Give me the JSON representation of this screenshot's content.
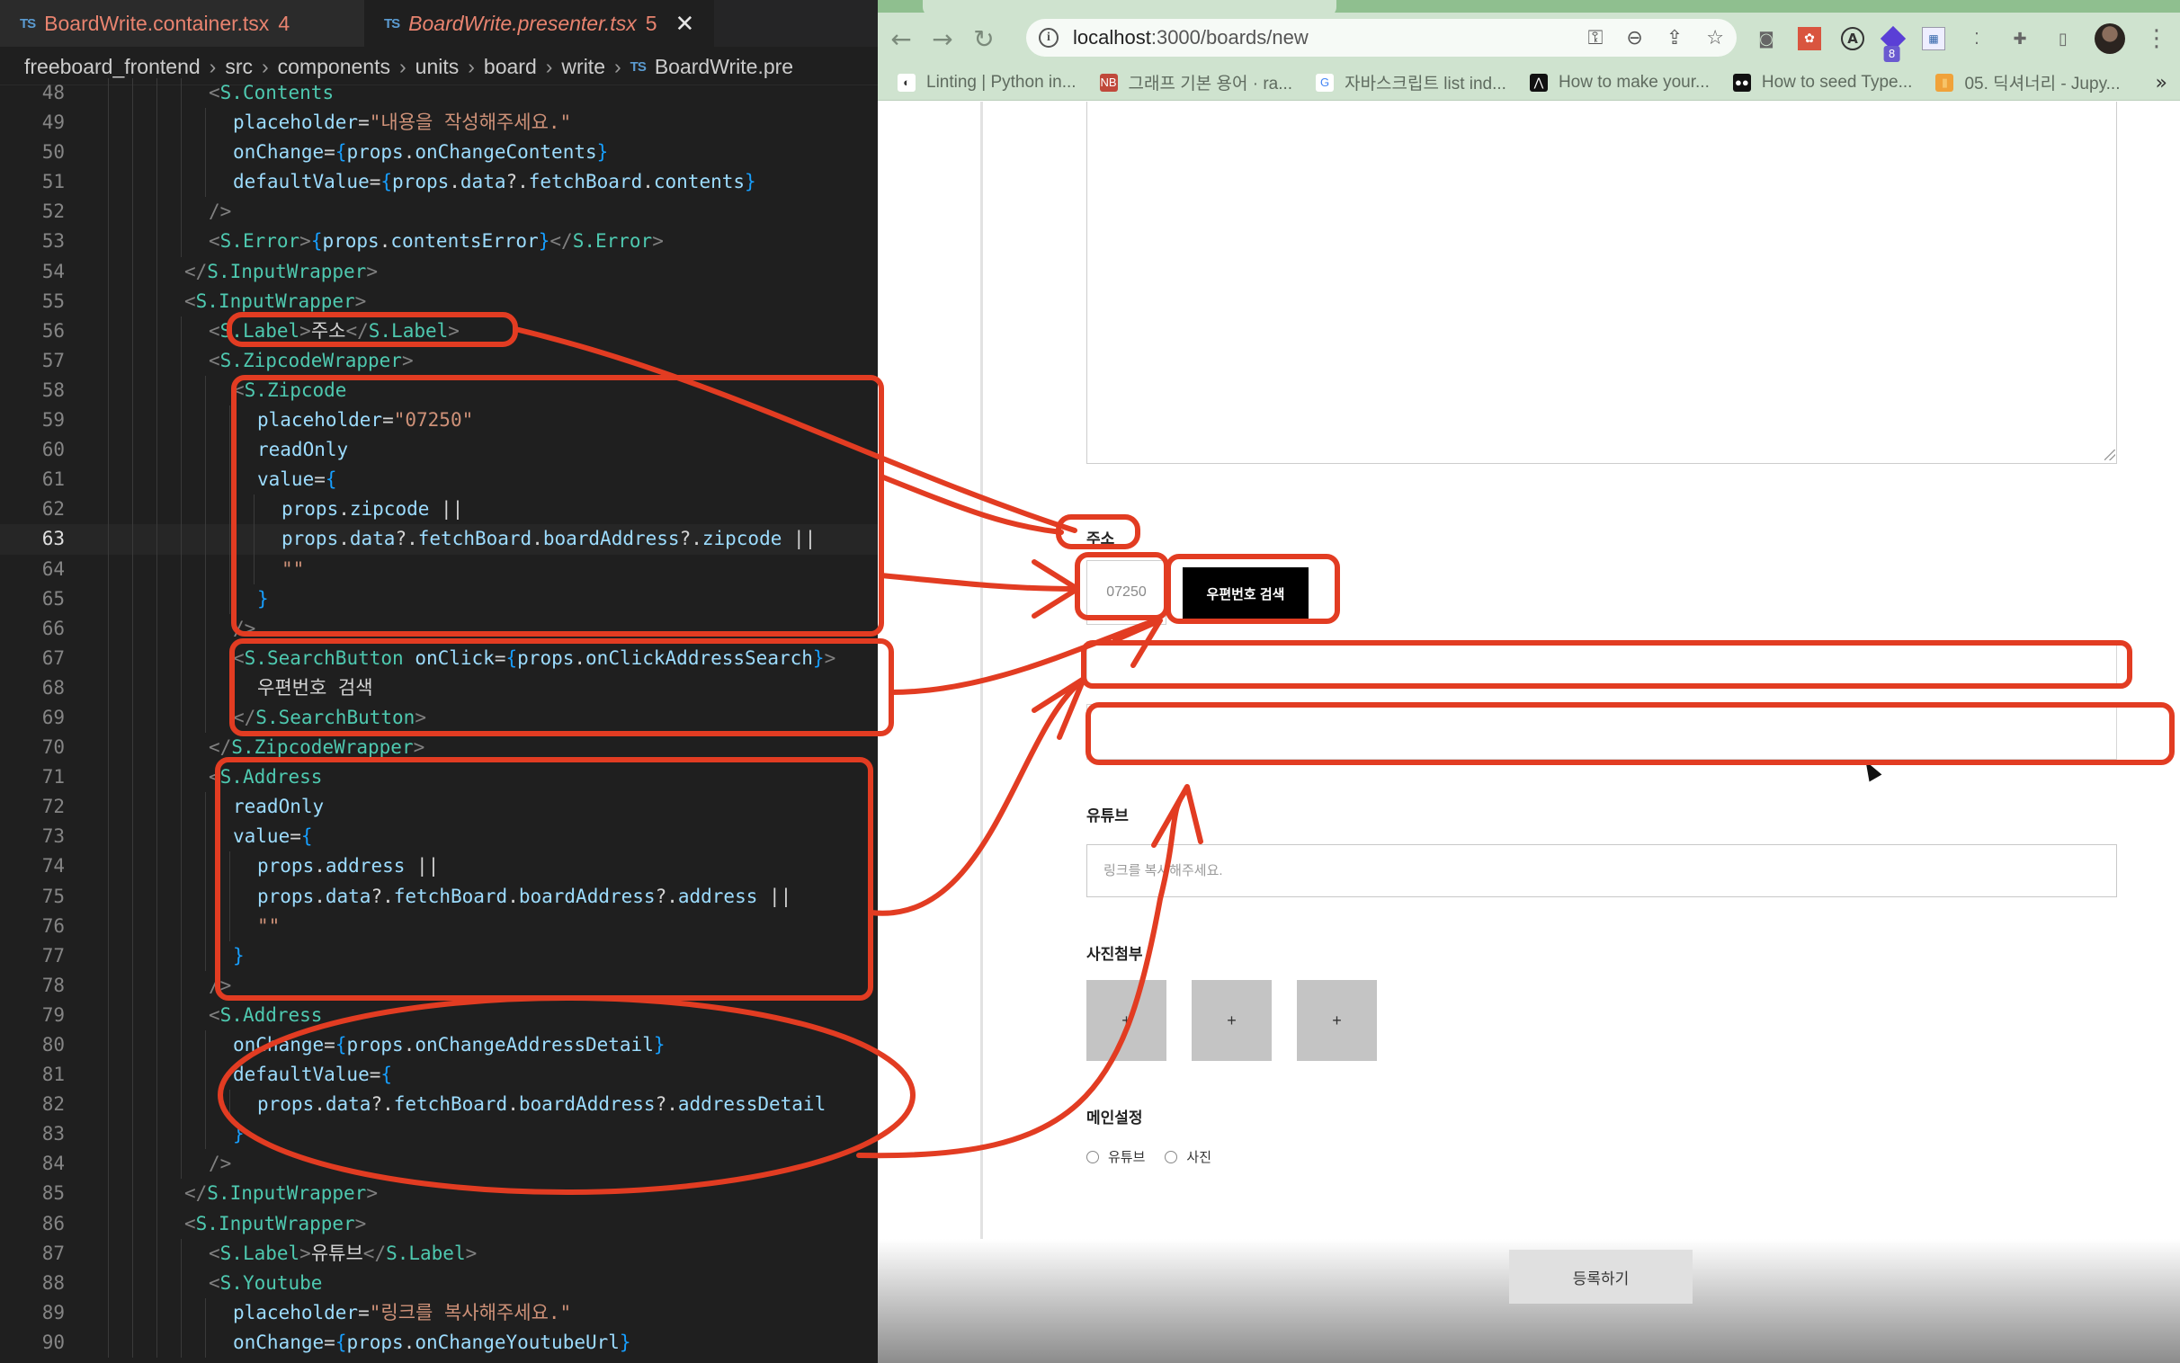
{
  "editor": {
    "tabs": [
      {
        "badge": "TS",
        "name": "BoardWrite.container.tsx",
        "count": "4",
        "active": false
      },
      {
        "badge": "TS",
        "name": "BoardWrite.presenter.tsx",
        "count": "5",
        "active": true,
        "close": "✕"
      }
    ],
    "breadcrumb": [
      "freeboard_frontend",
      "src",
      "components",
      "units",
      "board",
      "write",
      "BoardWrite.pre"
    ],
    "breadcrumb_sep": "›",
    "breadcrumb_file_badge": "TS",
    "current_line": 63,
    "lines": [
      {
        "n": "48",
        "indent": 4,
        "t": [
          [
            "tg",
            "<"
          ],
          [
            "cp",
            "S.Contents"
          ]
        ]
      },
      {
        "n": "49",
        "indent": 5,
        "t": [
          [
            "at",
            "placeholder"
          ],
          [
            "pl",
            "="
          ],
          [
            "st",
            "\"내용을 작성해주세요.\""
          ]
        ]
      },
      {
        "n": "50",
        "indent": 5,
        "t": [
          [
            "at",
            "onChange"
          ],
          [
            "pl",
            "="
          ],
          [
            "br",
            "{"
          ],
          [
            "vr",
            "props"
          ],
          [
            "pl",
            "."
          ],
          [
            "vr",
            "onChangeContents"
          ],
          [
            "br",
            "}"
          ]
        ]
      },
      {
        "n": "51",
        "indent": 5,
        "t": [
          [
            "at",
            "defaultValue"
          ],
          [
            "pl",
            "="
          ],
          [
            "br",
            "{"
          ],
          [
            "vr",
            "props"
          ],
          [
            "pl",
            "."
          ],
          [
            "vr",
            "data"
          ],
          [
            "pl",
            "?."
          ],
          [
            "vr",
            "fetchBoard"
          ],
          [
            "pl",
            "."
          ],
          [
            "vr",
            "contents"
          ],
          [
            "br",
            "}"
          ]
        ]
      },
      {
        "n": "52",
        "indent": 4,
        "t": [
          [
            "tg",
            "/>"
          ]
        ]
      },
      {
        "n": "53",
        "indent": 4,
        "t": [
          [
            "tg",
            "<"
          ],
          [
            "cp",
            "S.Error"
          ],
          [
            "tg",
            ">"
          ],
          [
            "br",
            "{"
          ],
          [
            "vr",
            "props"
          ],
          [
            "pl",
            "."
          ],
          [
            "vr",
            "contentsError"
          ],
          [
            "br",
            "}"
          ],
          [
            "tg",
            "</"
          ],
          [
            "cp",
            "S.Error"
          ],
          [
            "tg",
            ">"
          ]
        ]
      },
      {
        "n": "54",
        "indent": 3,
        "t": [
          [
            "tg",
            "</"
          ],
          [
            "cp",
            "S.InputWrapper"
          ],
          [
            "tg",
            ">"
          ]
        ]
      },
      {
        "n": "55",
        "indent": 3,
        "t": [
          [
            "tg",
            "<"
          ],
          [
            "cp",
            "S.InputWrapper"
          ],
          [
            "tg",
            ">"
          ]
        ]
      },
      {
        "n": "56",
        "indent": 4,
        "t": [
          [
            "tg",
            "<"
          ],
          [
            "cp",
            "S.Label"
          ],
          [
            "tg",
            ">"
          ],
          [
            "pl",
            "주소"
          ],
          [
            "tg",
            "</"
          ],
          [
            "cp",
            "S.Label"
          ],
          [
            "tg",
            ">"
          ]
        ]
      },
      {
        "n": "57",
        "indent": 4,
        "t": [
          [
            "tg",
            "<"
          ],
          [
            "cp",
            "S.ZipcodeWrapper"
          ],
          [
            "tg",
            ">"
          ]
        ]
      },
      {
        "n": "58",
        "indent": 5,
        "t": [
          [
            "tg",
            "<"
          ],
          [
            "cp",
            "S.Zipcode"
          ]
        ]
      },
      {
        "n": "59",
        "indent": 6,
        "t": [
          [
            "at",
            "placeholder"
          ],
          [
            "pl",
            "="
          ],
          [
            "st",
            "\"07250\""
          ]
        ]
      },
      {
        "n": "60",
        "indent": 6,
        "t": [
          [
            "at",
            "readOnly"
          ]
        ]
      },
      {
        "n": "61",
        "indent": 6,
        "t": [
          [
            "at",
            "value"
          ],
          [
            "pl",
            "="
          ],
          [
            "br",
            "{"
          ]
        ]
      },
      {
        "n": "62",
        "indent": 7,
        "t": [
          [
            "vr",
            "props"
          ],
          [
            "pl",
            "."
          ],
          [
            "vr",
            "zipcode"
          ],
          [
            "pl",
            " ||"
          ]
        ]
      },
      {
        "n": "63",
        "indent": 7,
        "t": [
          [
            "vr",
            "props"
          ],
          [
            "pl",
            "."
          ],
          [
            "vr",
            "data"
          ],
          [
            "pl",
            "?."
          ],
          [
            "vr",
            "fetchBoard"
          ],
          [
            "pl",
            "."
          ],
          [
            "vr",
            "boardAddress"
          ],
          [
            "pl",
            "?."
          ],
          [
            "vr",
            "zipcode"
          ],
          [
            "pl",
            " ||"
          ]
        ]
      },
      {
        "n": "64",
        "indent": 7,
        "t": [
          [
            "st",
            "\"\""
          ]
        ]
      },
      {
        "n": "65",
        "indent": 6,
        "t": [
          [
            "br",
            "}"
          ]
        ]
      },
      {
        "n": "66",
        "indent": 5,
        "t": [
          [
            "tg",
            "/>"
          ]
        ]
      },
      {
        "n": "67",
        "indent": 5,
        "t": [
          [
            "tg",
            "<"
          ],
          [
            "cp",
            "S.SearchButton"
          ],
          [
            "pl",
            " "
          ],
          [
            "at",
            "onClick"
          ],
          [
            "pl",
            "="
          ],
          [
            "br",
            "{"
          ],
          [
            "vr",
            "props"
          ],
          [
            "pl",
            "."
          ],
          [
            "vr",
            "onClickAddressSearch"
          ],
          [
            "br",
            "}"
          ],
          [
            "tg",
            ">"
          ]
        ]
      },
      {
        "n": "68",
        "indent": 6,
        "t": [
          [
            "pl",
            "우편번호 검색"
          ]
        ]
      },
      {
        "n": "69",
        "indent": 5,
        "t": [
          [
            "tg",
            "</"
          ],
          [
            "cp",
            "S.SearchButton"
          ],
          [
            "tg",
            ">"
          ]
        ]
      },
      {
        "n": "70",
        "indent": 4,
        "t": [
          [
            "tg",
            "</"
          ],
          [
            "cp",
            "S.ZipcodeWrapper"
          ],
          [
            "tg",
            ">"
          ]
        ]
      },
      {
        "n": "71",
        "indent": 4,
        "t": [
          [
            "tg",
            "<"
          ],
          [
            "cp",
            "S.Address"
          ]
        ]
      },
      {
        "n": "72",
        "indent": 5,
        "t": [
          [
            "at",
            "readOnly"
          ]
        ]
      },
      {
        "n": "73",
        "indent": 5,
        "t": [
          [
            "at",
            "value"
          ],
          [
            "pl",
            "="
          ],
          [
            "br",
            "{"
          ]
        ]
      },
      {
        "n": "74",
        "indent": 6,
        "t": [
          [
            "vr",
            "props"
          ],
          [
            "pl",
            "."
          ],
          [
            "vr",
            "address"
          ],
          [
            "pl",
            " ||"
          ]
        ]
      },
      {
        "n": "75",
        "indent": 6,
        "t": [
          [
            "vr",
            "props"
          ],
          [
            "pl",
            "."
          ],
          [
            "vr",
            "data"
          ],
          [
            "pl",
            "?."
          ],
          [
            "vr",
            "fetchBoard"
          ],
          [
            "pl",
            "."
          ],
          [
            "vr",
            "boardAddress"
          ],
          [
            "pl",
            "?."
          ],
          [
            "vr",
            "address"
          ],
          [
            "pl",
            " ||"
          ]
        ]
      },
      {
        "n": "76",
        "indent": 6,
        "t": [
          [
            "st",
            "\"\""
          ]
        ]
      },
      {
        "n": "77",
        "indent": 5,
        "t": [
          [
            "br",
            "}"
          ]
        ]
      },
      {
        "n": "78",
        "indent": 4,
        "t": [
          [
            "tg",
            "/>"
          ]
        ]
      },
      {
        "n": "79",
        "indent": 4,
        "t": [
          [
            "tg",
            "<"
          ],
          [
            "cp",
            "S.Address"
          ]
        ]
      },
      {
        "n": "80",
        "indent": 5,
        "t": [
          [
            "at",
            "onChange"
          ],
          [
            "pl",
            "="
          ],
          [
            "br",
            "{"
          ],
          [
            "vr",
            "props"
          ],
          [
            "pl",
            "."
          ],
          [
            "vr",
            "onChangeAddressDetail"
          ],
          [
            "br",
            "}"
          ]
        ]
      },
      {
        "n": "81",
        "indent": 5,
        "t": [
          [
            "at",
            "defaultValue"
          ],
          [
            "pl",
            "="
          ],
          [
            "br",
            "{"
          ]
        ]
      },
      {
        "n": "82",
        "indent": 6,
        "t": [
          [
            "vr",
            "props"
          ],
          [
            "pl",
            "."
          ],
          [
            "vr",
            "data"
          ],
          [
            "pl",
            "?."
          ],
          [
            "vr",
            "fetchBoard"
          ],
          [
            "pl",
            "."
          ],
          [
            "vr",
            "boardAddress"
          ],
          [
            "pl",
            "?."
          ],
          [
            "vr",
            "addressDetail"
          ]
        ]
      },
      {
        "n": "83",
        "indent": 5,
        "t": [
          [
            "br",
            "}"
          ]
        ]
      },
      {
        "n": "84",
        "indent": 4,
        "t": [
          [
            "tg",
            "/>"
          ]
        ]
      },
      {
        "n": "85",
        "indent": 3,
        "t": [
          [
            "tg",
            "</"
          ],
          [
            "cp",
            "S.InputWrapper"
          ],
          [
            "tg",
            ">"
          ]
        ]
      },
      {
        "n": "86",
        "indent": 3,
        "t": [
          [
            "tg",
            "<"
          ],
          [
            "cp",
            "S.InputWrapper"
          ],
          [
            "tg",
            ">"
          ]
        ]
      },
      {
        "n": "87",
        "indent": 4,
        "t": [
          [
            "tg",
            "<"
          ],
          [
            "cp",
            "S.Label"
          ],
          [
            "tg",
            ">"
          ],
          [
            "pl",
            "유튜브"
          ],
          [
            "tg",
            "</"
          ],
          [
            "cp",
            "S.Label"
          ],
          [
            "tg",
            ">"
          ]
        ]
      },
      {
        "n": "88",
        "indent": 4,
        "t": [
          [
            "tg",
            "<"
          ],
          [
            "cp",
            "S.Youtube"
          ]
        ]
      },
      {
        "n": "89",
        "indent": 5,
        "t": [
          [
            "at",
            "placeholder"
          ],
          [
            "pl",
            "="
          ],
          [
            "st",
            "\"링크를 복사해주세요.\""
          ]
        ]
      },
      {
        "n": "90",
        "indent": 5,
        "t": [
          [
            "at",
            "onChange"
          ],
          [
            "pl",
            "="
          ],
          [
            "br",
            "{"
          ],
          [
            "vr",
            "props"
          ],
          [
            "pl",
            "."
          ],
          [
            "vr",
            "onChangeYoutubeUrl"
          ],
          [
            "br",
            "}"
          ]
        ]
      }
    ]
  },
  "browser": {
    "nav": {
      "back": "←",
      "forward": "→",
      "reload": "↻"
    },
    "url_host": "localhost",
    "url_path": ":3000/boards/new",
    "omnibox_icons": [
      "key-icon",
      "zoom-icon",
      "share-icon",
      "star-icon"
    ],
    "extensions": [
      {
        "name": "camera-extension-icon",
        "glyph": "◙"
      },
      {
        "name": "react-devtools-extension-icon",
        "glyph": "✿"
      },
      {
        "name": "a-extension-icon",
        "glyph": "A"
      },
      {
        "name": "stack-extension-icon",
        "glyph": "",
        "badge": "8"
      },
      {
        "name": "sheet-extension-icon",
        "glyph": "▦"
      },
      {
        "name": "dots-extension-icon",
        "glyph": "⁚"
      },
      {
        "name": "puzzle-extensions-icon",
        "glyph": "✚"
      },
      {
        "name": "side-panel-icon",
        "glyph": "▯"
      }
    ],
    "menu": "⋮",
    "bookmarks": [
      {
        "label": "Linting | Python in...",
        "icon": "◐",
        "icon_bg": "#ffffff",
        "icon_color": "#333333"
      },
      {
        "label": "그래프 기본 용어 · ra...",
        "icon": "NB",
        "icon_bg": "#c0493b",
        "icon_color": "#ffffff"
      },
      {
        "label": "자바스크립트 list ind...",
        "icon": "G",
        "icon_bg": "#ffffff",
        "icon_color": "#4285f4"
      },
      {
        "label": "How to make your...",
        "icon": "⋀",
        "icon_bg": "#111111",
        "icon_color": "#ffffff"
      },
      {
        "label": "How to seed Type...",
        "icon": "●●",
        "icon_bg": "#111111",
        "icon_color": "#ffffff"
      },
      {
        "label": "05. 딕셔너리 - Jupy...",
        "icon": "▮",
        "icon_bg": "#f0a23a",
        "icon_color": "#f7c46a"
      }
    ],
    "bookmarks_more": "»"
  },
  "form": {
    "address_label": "주소",
    "zipcode_placeholder": "07250",
    "search_button": "우편번호 검색",
    "address_value": "",
    "address_detail_value": "",
    "youtube_label": "유튜브",
    "youtube_placeholder": "링크를 복사해주세요.",
    "photo_label": "사진첨부",
    "photo_add": "+",
    "photo_slots": 3,
    "main_setting_label": "메인설정",
    "radios": [
      {
        "label": "유튜브",
        "checked": false
      },
      {
        "label": "사진",
        "checked": false
      }
    ],
    "submit_button": "등록하기"
  },
  "annotation_color": "#e23c22"
}
